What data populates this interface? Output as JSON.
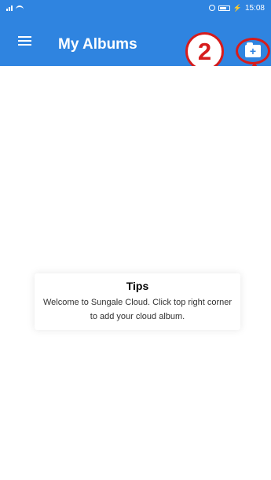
{
  "status_bar": {
    "time": "15:08"
  },
  "app_bar": {
    "title": "My Albums"
  },
  "annotation": {
    "step_number": "2"
  },
  "tips": {
    "title": "Tips",
    "message": "Welcome to Sungale Cloud. Click top right corner to add your cloud album."
  },
  "colors": {
    "app_bar": "#2f84e0",
    "annotation": "#d61c1c",
    "background": "#ffffff"
  },
  "icons": {
    "menu": "menu-icon",
    "add_album": "folder-plus-icon",
    "pointer": "up-arrow-icon"
  }
}
